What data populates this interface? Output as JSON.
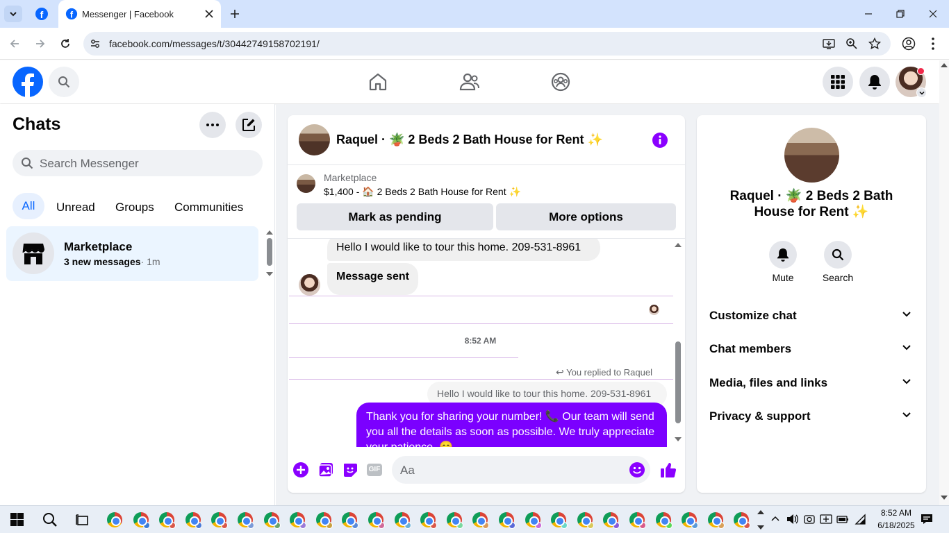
{
  "browser": {
    "tab_title": "Messenger | Facebook",
    "url": "facebook.com/messages/t/30442749158702191/"
  },
  "left": {
    "title": "Chats",
    "search_placeholder": "Search Messenger",
    "filters": [
      "All",
      "Unread",
      "Groups",
      "Communities"
    ],
    "chat_item": {
      "name": "Marketplace",
      "preview": "3 new messages",
      "time": "· 1m"
    }
  },
  "thread": {
    "title": "Raquel · 🪴 2 Beds 2 Bath House for Rent ✨",
    "listing_label": "Marketplace",
    "listing_text": "$1,400 - 🏠 2 Beds 2 Bath House for Rent ✨",
    "mark_pending": "Mark as pending",
    "more_options": "More options",
    "msg1": "Hello I would like to tour this home. 209-531-8961",
    "msg2": "Message sent",
    "timestamp": "8:52 AM",
    "replied": "You replied to Raquel",
    "quoted": "Hello I would like to tour this home. 209-531-8961",
    "outgoing": "Thank you for sharing your number! 📞 Our team will send you all the details as soon as possible. We truly appreciate your patience. 😊",
    "composer_placeholder": "Aa"
  },
  "right": {
    "name": "Raquel · 🪴 2 Beds 2 Bath House for Rent ✨",
    "mute": "Mute",
    "search": "Search",
    "sections": [
      "Customize chat",
      "Chat members",
      "Media, files and links",
      "Privacy & support"
    ]
  },
  "taskbar": {
    "time": "8:52 AM",
    "date": "6/18/2025"
  },
  "colors": {
    "fb_blue": "#0866ff",
    "messenger_purple": "#8a00ff",
    "outgoing_bubble": "#7b00ff",
    "tab_bar": "#d3e3fd"
  }
}
